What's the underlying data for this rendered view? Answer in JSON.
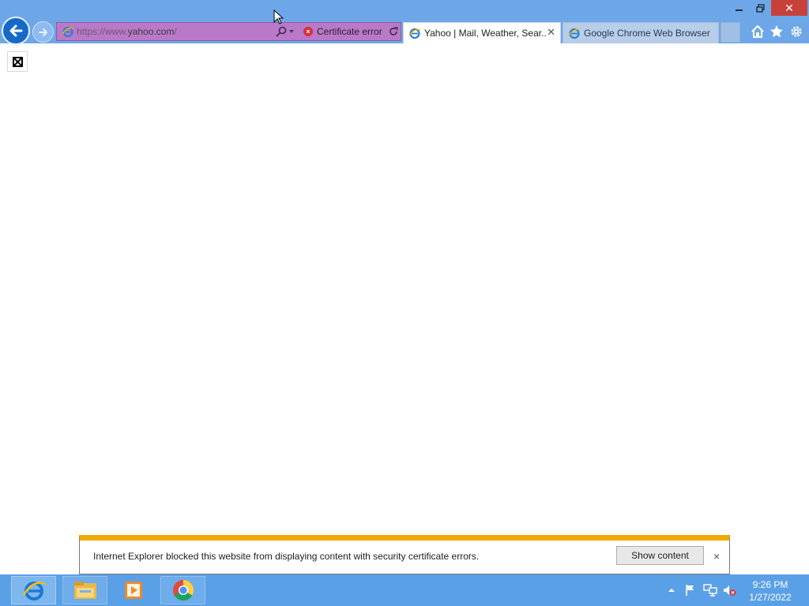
{
  "browser": {
    "address": {
      "url_prefix": "https://www.",
      "url_domain": "yahoo.com",
      "url_suffix": "/",
      "cert_status": "Certificate error"
    },
    "tabs": [
      {
        "label": "Yahoo | Mail, Weather, Sear...",
        "active": true
      },
      {
        "label": "Google Chrome Web Browser",
        "active": false
      }
    ],
    "tab_close_glyph": "✕",
    "window_close_glyph": "✕",
    "toolbar_icons": [
      "home-icon",
      "favorites-star-icon",
      "tools-gear-icon"
    ]
  },
  "notification": {
    "message": "Internet Explorer blocked this website from displaying content with security certificate errors.",
    "button_label": "Show content",
    "close_glyph": "×",
    "accent_color": "#f2a900"
  },
  "taskbar": {
    "pinned": [
      "internet-explorer-icon",
      "file-explorer-icon",
      "media-player-icon",
      "chrome-icon"
    ],
    "clock": {
      "time": "9:26 PM",
      "date": "1/27/2022"
    }
  },
  "colors": {
    "titlebar": "#6ea7e8",
    "address_error": "#b979c8",
    "taskbar": "#5aa0e6",
    "close_button": "#c7413b"
  }
}
